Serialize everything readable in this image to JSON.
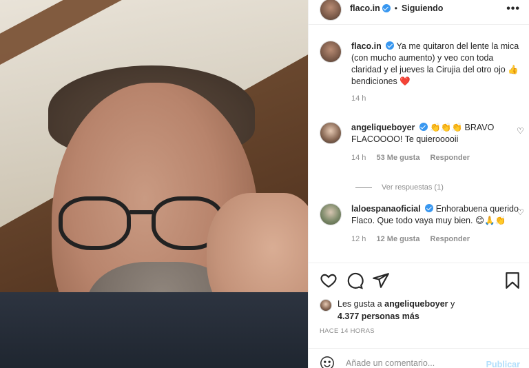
{
  "post": {
    "username": "flaco.in",
    "follow_status": "Siguiendo",
    "separator": "•",
    "more_glyph": "•••"
  },
  "caption": {
    "username": "flaco.in",
    "text": "Ya me quitaron del lente la mica (con mucho aumento) y veo con toda claridad y el jueves la Cirujia del otro ojo 👍 bendiciones ❤️",
    "time": "14 h"
  },
  "comments": [
    {
      "username": "angeliqueboyer",
      "text": "👏👏👏 BRAVO FLACOOOO! Te quierooooii",
      "time": "14 h",
      "likes": "53 Me gusta",
      "reply_label": "Responder"
    },
    {
      "username": "laloespanaoficial",
      "text": "Enhorabuena querido Flaco. Que todo vaya muy bien. 😊🙏👏",
      "time": "12 h",
      "likes": "12 Me gusta",
      "reply_label": "Responder"
    }
  ],
  "view_replies": "Ver respuestas (1)",
  "likes_summary": {
    "prefix": "Les gusta a",
    "user": "angeliqueboyer",
    "joiner": "y",
    "others": "4.377 personas más"
  },
  "time_ago": "HACE 14 HORAS",
  "add_comment": {
    "placeholder": "Añade un comentario...",
    "publish_label": "Publicar"
  },
  "icons": {
    "like": "heart-icon",
    "comment": "comment-icon",
    "share": "share-icon",
    "save": "bookmark-icon",
    "emoji": "emoji-icon"
  },
  "colors": {
    "verified": "#3897f0",
    "publish_disabled": "#b2dffc",
    "muted": "#8e8e8e"
  }
}
